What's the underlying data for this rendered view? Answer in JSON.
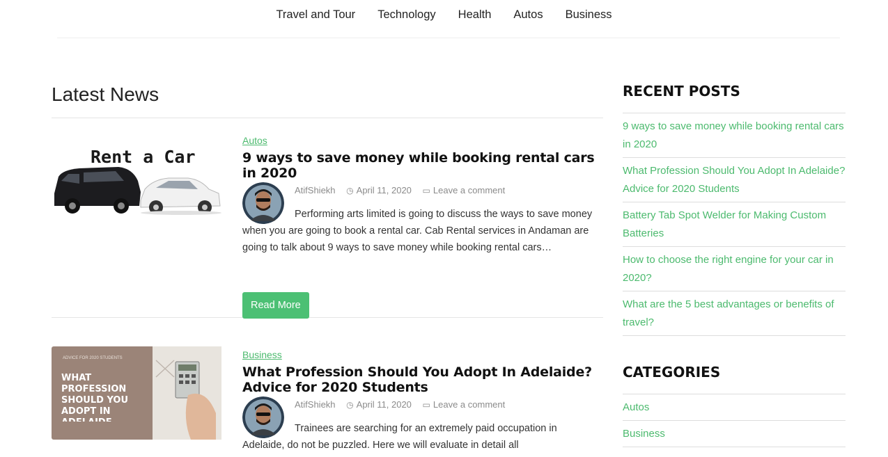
{
  "nav": {
    "items": [
      "Travel and Tour",
      "Technology",
      "Health",
      "Autos",
      "Business"
    ]
  },
  "main": {
    "section_title": "Latest News",
    "posts": [
      {
        "category": "Autos",
        "title": "9 ways to save money while booking rental cars in 2020",
        "author": "AtifShiekh",
        "date": "April 11, 2020",
        "comment": "Leave a comment",
        "excerpt": "Performing arts limited is going to discuss the ways to save money when you are going to book a rental car. Cab Rental services in Andaman are going to talk about 9 ways to save money while booking rental cars…",
        "read_more": "Read More",
        "thumb_text": "Rent a Car"
      },
      {
        "category": "Business",
        "title": "What Profession Should You Adopt In Adelaide? Advice for 2020 Students",
        "author": "AtifShiekh",
        "date": "April 11, 2020",
        "comment": "Leave a comment",
        "excerpt": "Trainees are searching for an extremely paid occupation in Adelaide, do not be puzzled. Here we will evaluate in detail all",
        "thumb_small": "ADVICE FOR 2020 STUDENTS",
        "thumb_text": "WHAT PROFESSION SHOULD YOU ADOPT IN ADELAIDE"
      }
    ]
  },
  "sidebar": {
    "recent_title": "RECENT POSTS",
    "recent": [
      "9 ways to save money while booking rental cars in 2020",
      "What Profession Should You Adopt In Adelaide? Advice for 2020 Students",
      "Battery Tab Spot Welder for Making Custom Batteries",
      "How to choose the right engine for your car in 2020?",
      "What are the 5 best advantages or benefits of travel?"
    ],
    "categories_title": "CATEGORIES",
    "categories": [
      "Autos",
      "Business"
    ]
  },
  "colors": {
    "accent": "#4cba6e",
    "button": "#4cc074"
  }
}
